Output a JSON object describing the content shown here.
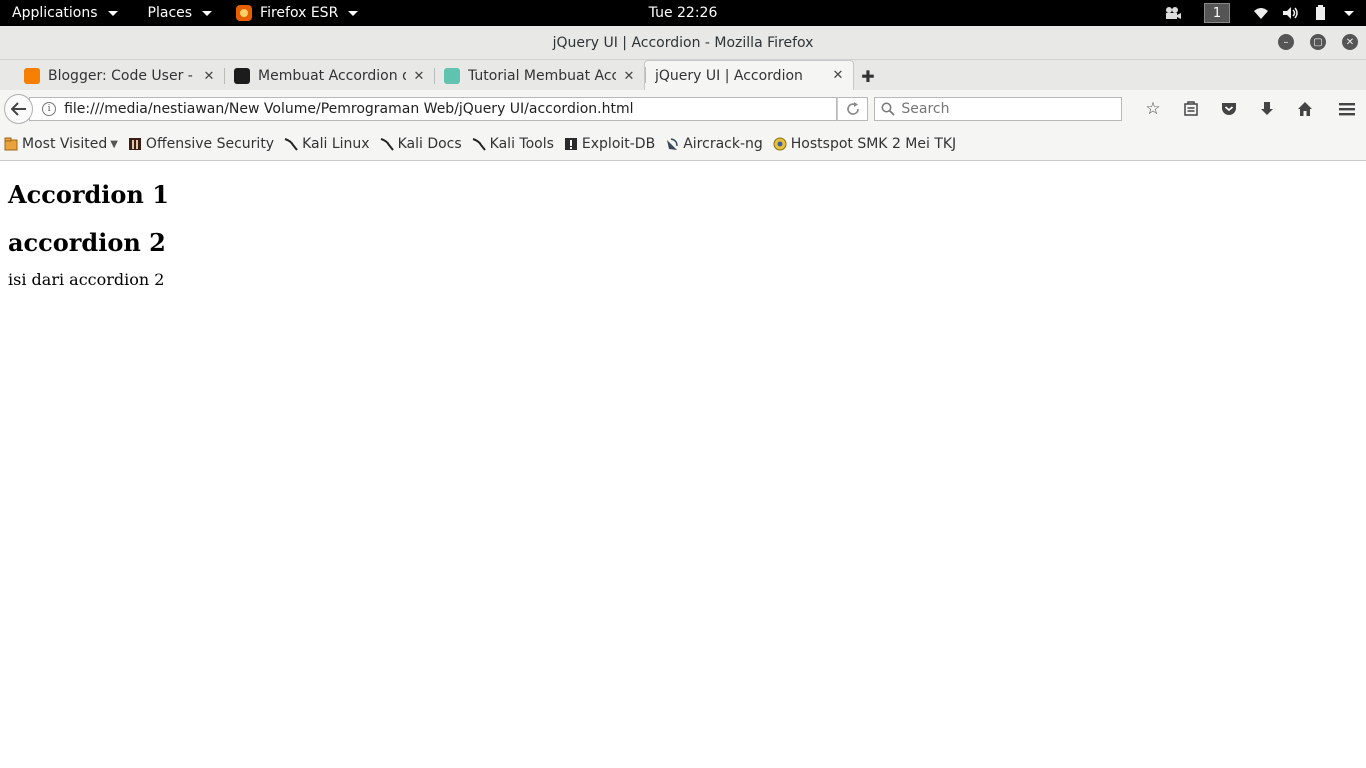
{
  "topbar": {
    "applications_label": "Applications",
    "places_label": "Places",
    "app_label": "Firefox ESR",
    "clock": "Tue 22:26",
    "workspace": "1"
  },
  "window": {
    "title": "jQuery UI | Accordion - Mozilla Firefox"
  },
  "tabs": [
    {
      "label": "Blogger: Code User - ...",
      "favicon_color": "#f57d00"
    },
    {
      "label": "Membuat Accordion d...",
      "favicon_color": "#1c1c1c"
    },
    {
      "label": "Tutorial Membuat Acc...",
      "favicon_color": "#5fc3b0"
    },
    {
      "label": "jQuery UI | Accordion",
      "favicon_color": ""
    }
  ],
  "navbar": {
    "url": "file:///media/nestiawan/New Volume/Pemrograman Web/jQuery UI/accordion.html",
    "search_placeholder": "Search"
  },
  "bookmarks": [
    {
      "label": "Most Visited",
      "icon": "most-visited-icon"
    },
    {
      "label": "Offensive Security",
      "icon": "offsec-icon"
    },
    {
      "label": "Kali Linux",
      "icon": "kali-icon"
    },
    {
      "label": "Kali Docs",
      "icon": "kali-icon"
    },
    {
      "label": "Kali Tools",
      "icon": "kali-icon"
    },
    {
      "label": "Exploit-DB",
      "icon": "exploitdb-icon"
    },
    {
      "label": "Aircrack-ng",
      "icon": "aircrack-icon"
    },
    {
      "label": "Hostspot SMK 2 Mei TKJ",
      "icon": "hotspot-icon"
    }
  ],
  "page": {
    "heading1": "Accordion 1",
    "heading2": "accordion 2",
    "body2": "isi dari accordion 2"
  }
}
